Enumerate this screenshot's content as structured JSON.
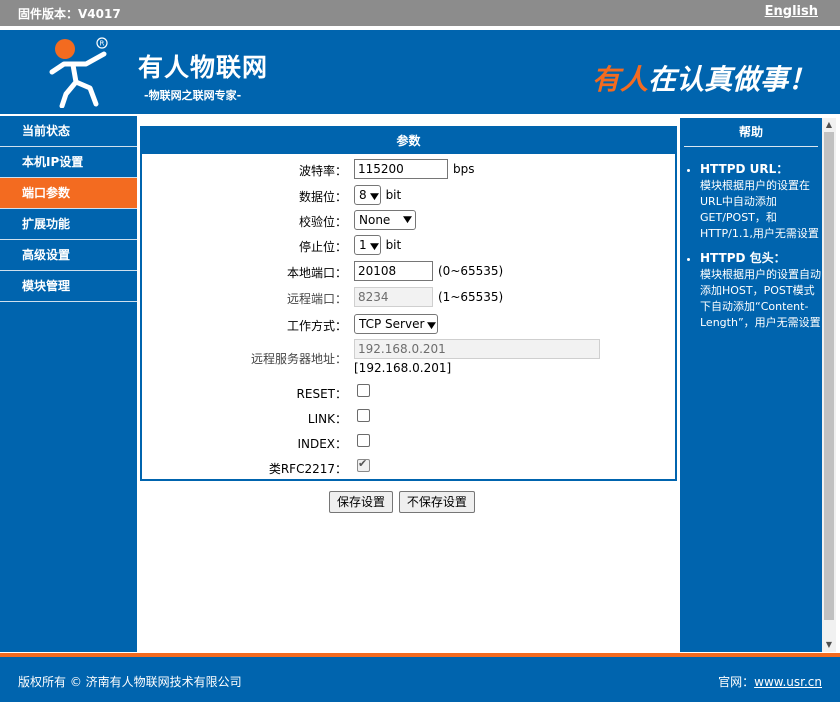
{
  "topbar": {
    "firmware": "固件版本：V4017",
    "language_link": "English"
  },
  "header": {
    "brand": "有人物联网",
    "brand_sub": "-物联网之联网专家-",
    "slogan_accent": "有人",
    "slogan_rest": "在认真做事！"
  },
  "sidebar": {
    "items": [
      {
        "label": "当前状态"
      },
      {
        "label": "本机IP设置"
      },
      {
        "label": "端口参数",
        "active": true
      },
      {
        "label": "扩展功能"
      },
      {
        "label": "高级设置"
      },
      {
        "label": "模块管理"
      }
    ]
  },
  "panel": {
    "title": "参数",
    "baud": {
      "label": "波特率：",
      "value": "115200",
      "unit": "bps"
    },
    "databits": {
      "label": "数据位：",
      "value": "8",
      "unit": "bit"
    },
    "parity": {
      "label": "校验位：",
      "value": "None"
    },
    "stopbits": {
      "label": "停止位：",
      "value": "1",
      "unit": "bit"
    },
    "local_port": {
      "label": "本地端口：",
      "value": "20108",
      "range": "(0~65535)"
    },
    "remote_port": {
      "label": "远程端口：",
      "value": "8234",
      "range": "(1~65535)"
    },
    "mode": {
      "label": "工作方式：",
      "value": "TCP Server"
    },
    "remote_server": {
      "label": "远程服务器地址：",
      "value": "192.168.0.201",
      "note": "[192.168.0.201]"
    },
    "reset": {
      "label": "RESET：",
      "checked": false
    },
    "link": {
      "label": "LINK：",
      "checked": false
    },
    "index": {
      "label": "INDEX：",
      "checked": false
    },
    "rfc2217": {
      "label": "类RFC2217：",
      "checked": true
    }
  },
  "buttons": {
    "save": "保存设置",
    "nosave": "不保存设置"
  },
  "help": {
    "title": "帮助",
    "items": [
      {
        "heading": "HTTPD URL：",
        "text": "模块根据用户的设置在URL中自动添加GET/POST，和HTTP/1.1,用户无需设置"
      },
      {
        "heading": "HTTPD 包头：",
        "text": "模块根据用户的设置自动添加HOST，POST模式下自动添加“Content-Length”，用户无需设置"
      }
    ]
  },
  "footer": {
    "copyright": "版权所有 © 济南有人物联网技术有限公司",
    "site_label": "官网：",
    "site_link": "www.usr.cn"
  },
  "colors": {
    "primary": "#0064ae",
    "accent": "#f36b20",
    "topbar": "#8c8c8c"
  },
  "icons": {
    "logo": "running-man-logo-icon",
    "scroll_up": "arrow-up-icon",
    "scroll_down": "arrow-down-icon"
  }
}
